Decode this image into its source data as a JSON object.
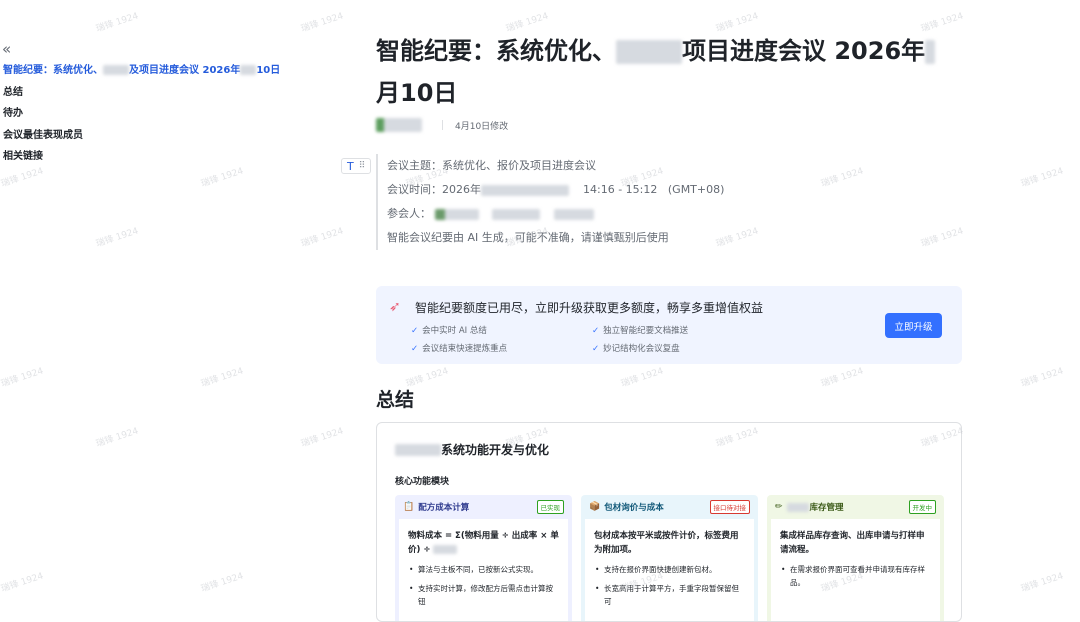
{
  "outline": {
    "collapse_icon": "«",
    "items": [
      {
        "label": "智能纪要：系统优化、",
        "label_tail_a": "及项目进度会议 2026年",
        "label_tail_b": "10日",
        "active": true
      },
      {
        "label": "总结"
      },
      {
        "label": "待办"
      },
      {
        "label": "会议最佳表现成员"
      },
      {
        "label": "相关链接"
      }
    ]
  },
  "doc": {
    "title_part1": "智能纪要：系统优化、",
    "title_part2": "项目进度会议 2026年",
    "title_part3": "月10日",
    "modified": "4月10日修改"
  },
  "block_handle": {
    "text_icon": "T",
    "grip_icon": "⠿"
  },
  "meeting_info": {
    "topic": "会议主题：系统优化、报价及项目进度会议",
    "time_label": "会议时间：2026年",
    "time_range": "14:16 - 15:12",
    "timezone": "(GMT+08)",
    "participants_label": "参会人：",
    "disclaimer": "智能会议纪要由 AI 生成，可能不准确，请谨慎甄别后使用"
  },
  "banner": {
    "icon": "rocket-icon",
    "title": "智能纪要额度已用尽，立即升级获取更多额度，畅享多重增值权益",
    "features": [
      "会中实时 AI 总结",
      "独立智能纪要文档推送",
      "会议结束快速提炼重点",
      "妙记结构化会议复盘"
    ],
    "button": "立即升级"
  },
  "summary": {
    "heading": "总结",
    "card_title": "系统功能开发与优化",
    "card_subtitle": "核心功能模块",
    "modules": [
      {
        "icon": "📋",
        "title": "配方成本计算",
        "badge": "已实现",
        "desc": "物料成本 = Σ(物料用量 ÷ 出成率 × 单价) ÷",
        "bullets": [
          "算法与主板不同，已按新公式实现。",
          "支持实时计算，修改配方后需点击计算按钮"
        ]
      },
      {
        "icon": "📦",
        "title": "包材询价与成本",
        "badge": "接口待对接",
        "desc": "包材成本按平米或按件计价，标签费用为附加项。",
        "bullets": [
          "支持在报价界面快捷创建新包材。",
          "长宽高用于计算平方，手重字段暂保留但可"
        ]
      },
      {
        "icon": "✏",
        "title": "库存管理",
        "badge": "开发中",
        "desc": "集成样品库存查询、出库申请与打样申请流程。",
        "bullets": [
          "在需求报价界面可查看并申请现有库存样品。"
        ]
      }
    ]
  },
  "colors": {
    "accent": "#3370ff",
    "link": "#245bdb",
    "banner_bg": "#f0f4ff"
  },
  "watermark": "瑞锋 1924"
}
